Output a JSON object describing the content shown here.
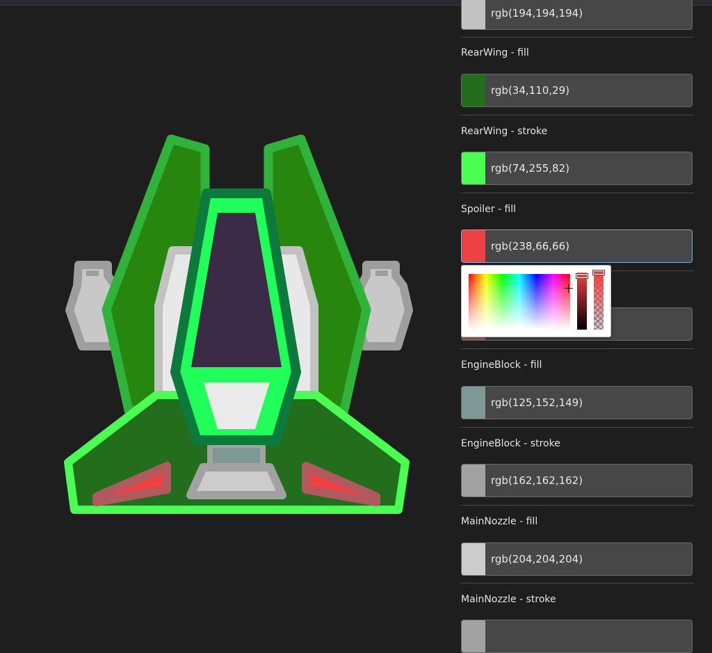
{
  "properties": [
    {
      "label": "",
      "value": "rgb(194,194,194)",
      "color": "#c2c2c2",
      "active": false
    },
    {
      "label": "RearWing - fill",
      "value": "rgb(34,110,29)",
      "color": "#226e1d",
      "active": false
    },
    {
      "label": "RearWing - stroke",
      "value": "rgb(74,255,82)",
      "color": "#4aff52",
      "active": false
    },
    {
      "label": "Spoiler - fill",
      "value": "rgb(238,66,66)",
      "color": "#ee4242",
      "active": true
    },
    {
      "label": "",
      "value": "",
      "color": "#b0595e",
      "active": false
    },
    {
      "label": "EngineBlock - fill",
      "value": "rgb(125,152,149)",
      "color": "#7d9895",
      "active": false
    },
    {
      "label": "EngineBlock - stroke",
      "value": "rgb(162,162,162)",
      "color": "#a2a2a2",
      "active": false
    },
    {
      "label": "MainNozzle - fill",
      "value": "rgb(204,204,204)",
      "color": "#cccccc",
      "active": false
    },
    {
      "label": "MainNozzle - stroke",
      "value": "",
      "color": "#a2a2a2",
      "active": false
    }
  ],
  "picker": {
    "hue_color": "#ee4242"
  },
  "theme": {
    "background": "#1e1e1e",
    "field_bg": "#474747",
    "active_border": "#79aee0"
  }
}
